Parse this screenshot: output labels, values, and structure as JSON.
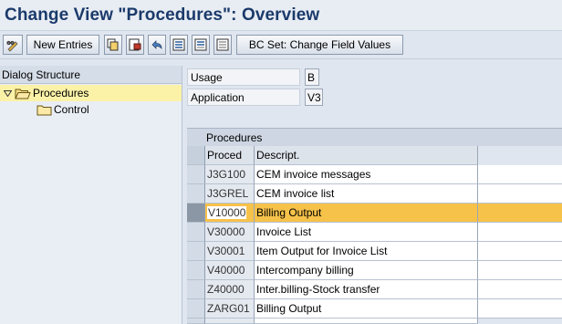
{
  "window": {
    "title": "Change View \"Procedures\": Overview"
  },
  "toolbar": {
    "new_entries_label": "New Entries",
    "bc_set_label": "BC Set: Change Field Values"
  },
  "dialog_structure": {
    "header": "Dialog Structure",
    "items": [
      {
        "label": "Procedures",
        "selected": true,
        "expanded": true
      },
      {
        "label": "Control",
        "selected": false
      }
    ]
  },
  "fields": {
    "usage": {
      "label": "Usage",
      "value": "B"
    },
    "application": {
      "label": "Application",
      "value": "V3"
    }
  },
  "table": {
    "title": "Procedures",
    "columns": [
      "Proced",
      "Descript."
    ],
    "rows": [
      {
        "code": "J3G100",
        "desc": "CEM invoice messages"
      },
      {
        "code": "J3GREL",
        "desc": "CEM invoice list"
      },
      {
        "code": "V10000",
        "desc": "Billing Output",
        "highlighted": true
      },
      {
        "code": "V30000",
        "desc": "Invoice List"
      },
      {
        "code": "V30001",
        "desc": "Item Output for Invoice List"
      },
      {
        "code": "V40000",
        "desc": "Intercompany billing"
      },
      {
        "code": "Z40000",
        "desc": "Inter.billing-Stock transfer"
      },
      {
        "code": "ZARG01",
        "desc": "Billing Output"
      }
    ]
  },
  "colors": {
    "title": "#1b3a6b",
    "highlight_row": "#f7c24a",
    "selected_tree_item": "#fbf2a8"
  }
}
